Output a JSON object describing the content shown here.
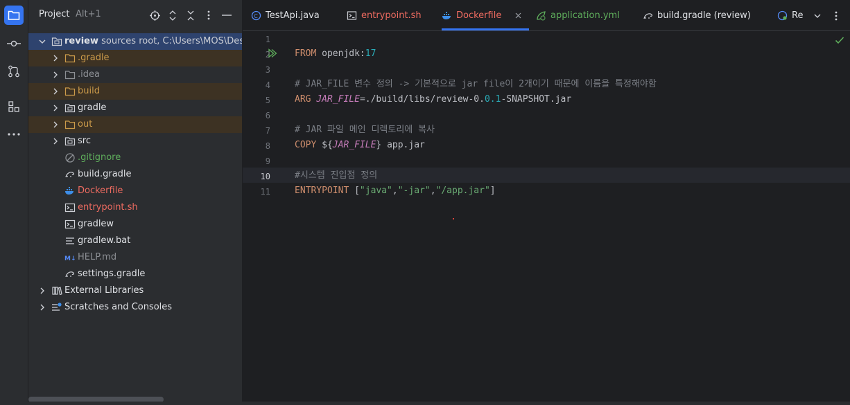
{
  "project_panel": {
    "title": "Project",
    "shortcut": "Alt+1",
    "root": {
      "name": "review",
      "hint": " sources root,  C:\\Users\\MOS\\Des"
    },
    "items": [
      {
        "label": ".gradle",
        "kind": "folder",
        "color": "orange",
        "expandable": true,
        "excluded": true
      },
      {
        "label": ".idea",
        "kind": "folder",
        "color": "gray",
        "expandable": true,
        "excluded": false
      },
      {
        "label": "build",
        "kind": "folder",
        "color": "orange",
        "expandable": true,
        "excluded": true
      },
      {
        "label": "gradle",
        "kind": "module-folder",
        "color": "normal",
        "expandable": true,
        "excluded": false
      },
      {
        "label": "out",
        "kind": "folder",
        "color": "orange",
        "expandable": true,
        "excluded": true
      },
      {
        "label": "src",
        "kind": "module-folder",
        "color": "normal",
        "expandable": true,
        "excluded": false
      },
      {
        "label": ".gitignore",
        "kind": "ignore-file",
        "color": "green",
        "expandable": false,
        "excluded": false
      },
      {
        "label": "build.gradle",
        "kind": "gradle-file",
        "color": "normal",
        "expandable": false,
        "excluded": false
      },
      {
        "label": "Dockerfile",
        "kind": "docker-file",
        "color": "red",
        "expandable": false,
        "excluded": false
      },
      {
        "label": "entrypoint.sh",
        "kind": "shell-file",
        "color": "red",
        "expandable": false,
        "excluded": false
      },
      {
        "label": "gradlew",
        "kind": "shell-file",
        "color": "normal",
        "expandable": false,
        "excluded": false
      },
      {
        "label": "gradlew.bat",
        "kind": "text-file",
        "color": "normal",
        "expandable": false,
        "excluded": false
      },
      {
        "label": "HELP.md",
        "kind": "markdown-file",
        "color": "gray",
        "expandable": false,
        "excluded": false
      },
      {
        "label": "settings.gradle",
        "kind": "gradle-file",
        "color": "normal",
        "expandable": false,
        "excluded": false
      }
    ],
    "external": [
      {
        "label": "External Libraries",
        "kind": "library"
      },
      {
        "label": "Scratches and Consoles",
        "kind": "scratches"
      }
    ]
  },
  "tabs": [
    {
      "label": "TestApi.java",
      "icon": "java-class-icon",
      "color": "normal",
      "active": false
    },
    {
      "label": "entrypoint.sh",
      "icon": "shell-file-icon",
      "color": "red",
      "active": false
    },
    {
      "label": "Dockerfile",
      "icon": "docker-icon",
      "color": "red",
      "active": true
    },
    {
      "label": "application.yml",
      "icon": "spring-yml-icon",
      "color": "green",
      "active": false
    },
    {
      "label": "build.gradle (review)",
      "icon": "gradle-icon",
      "color": "normal",
      "active": false
    },
    {
      "label": "Re",
      "icon": "spring-class-icon",
      "color": "normal",
      "active": false
    }
  ],
  "editor": {
    "line_numbers": [
      "1",
      "2",
      "3",
      "4",
      "5",
      "6",
      "7",
      "8",
      "9",
      "10",
      "11"
    ],
    "current_line": "10",
    "lines": [
      [],
      [
        {
          "t": "FROM ",
          "c": "kw"
        },
        {
          "t": "openjdk:",
          "c": "txt"
        },
        {
          "t": "17",
          "c": "num"
        }
      ],
      [],
      [
        {
          "t": "# JAR_FILE 변수 정의 -> 기본적으로 jar file이 2개이기 때문에 이름을 특정해야함",
          "c": "cmt"
        }
      ],
      [
        {
          "t": "ARG ",
          "c": "kw"
        },
        {
          "t": "JAR_FILE",
          "c": "var"
        },
        {
          "t": "=./build/libs/review-0.",
          "c": "txt"
        },
        {
          "t": "0.1",
          "c": "num"
        },
        {
          "t": "-SNAPSHOT.jar",
          "c": "txt"
        }
      ],
      [],
      [
        {
          "t": "# JAR 파일 메인 디렉토리에 복사",
          "c": "cmt"
        }
      ],
      [
        {
          "t": "COPY ",
          "c": "kw"
        },
        {
          "t": "${",
          "c": "txt"
        },
        {
          "t": "JAR_FILE",
          "c": "var"
        },
        {
          "t": "} app.jar",
          "c": "txt"
        }
      ],
      [],
      [
        {
          "t": "#시스템 진입점 정의",
          "c": "cmt"
        }
      ],
      [
        {
          "t": "ENTRYPOINT ",
          "c": "kw"
        },
        {
          "t": "[",
          "c": "txt"
        },
        {
          "t": "\"java\"",
          "c": "str"
        },
        {
          "t": ",",
          "c": "txt"
        },
        {
          "t": "\"-jar\"",
          "c": "str"
        },
        {
          "t": ",",
          "c": "txt"
        },
        {
          "t": "\"/app.jar\"",
          "c": "str"
        },
        {
          "t": "]",
          "c": "txt"
        }
      ]
    ]
  },
  "colors": {
    "accent": "#3574f0",
    "excluded_folder": "#cc9b4a",
    "vcs_new": "#5fae5c",
    "vcs_modified": "#ee6b60",
    "keyword": "#cf8e6d",
    "number": "#2aacb8",
    "comment": "#7a7e85"
  }
}
